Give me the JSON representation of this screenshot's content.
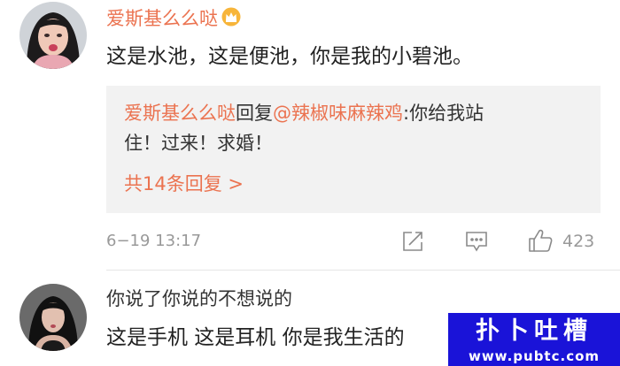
{
  "comment1": {
    "username": "爱斯基么么哒",
    "badge_icon": "crown-icon",
    "text": "这是水池，这是便池，你是我的小碧池。",
    "reply": {
      "author": "爱斯基么么哒",
      "action": "回复",
      "mention": "@辣椒味麻辣鸡",
      "content_line1": ":你给我站",
      "content_line2": "住！过来！求婚！",
      "count_label": "共14条回复 >"
    },
    "time": "6−19 13:17",
    "icons": [
      "share-icon",
      "comment-icon",
      "like-icon"
    ],
    "likes": "423"
  },
  "comment2": {
    "text_line1": "你说了你说的不想说的",
    "text_line2": "这是手机 这是耳机 你是我生活的"
  },
  "watermark": {
    "title": "扑卜吐槽",
    "url": "www.pubtc.com"
  },
  "colors": {
    "accent": "#eb7350",
    "watermark_bg": "#1a13d8"
  }
}
